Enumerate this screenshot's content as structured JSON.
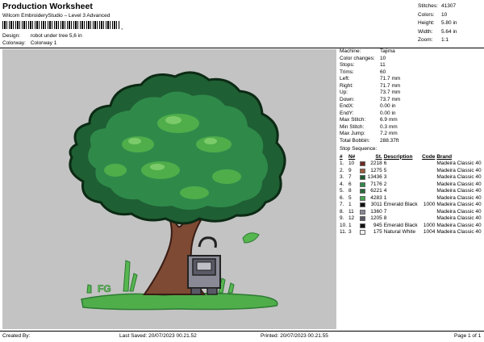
{
  "header": {
    "title": "Production Worksheet",
    "subtitle": "Wilcom EmbroideryStudio – Level 3 Advanced",
    "barcode_tick": ","
  },
  "meta": {
    "design_label": "Design:",
    "design_value": "robot under  tree 5,6 in",
    "colorway_label": "Colorway:",
    "colorway_value": "Colorway 1"
  },
  "stats": [
    {
      "k": "Stitches:",
      "v": "41307"
    },
    {
      "k": "Colors:",
      "v": "10"
    },
    {
      "k": "Height:",
      "v": "5.80 in"
    },
    {
      "k": "Width:",
      "v": "5.64 in"
    },
    {
      "k": "Zoom:",
      "v": "1:1"
    }
  ],
  "machine_info": [
    {
      "k": "Machine:",
      "v": "Tajima"
    },
    {
      "k": "Color changes:",
      "v": "10"
    },
    {
      "k": "Stops:",
      "v": "11"
    },
    {
      "k": "Trims:",
      "v": "60"
    },
    {
      "k": "Left:",
      "v": "71.7 mm"
    },
    {
      "k": "Right:",
      "v": "71.7 mm"
    },
    {
      "k": "Up:",
      "v": "73.7 mm"
    },
    {
      "k": "Down:",
      "v": "73.7 mm"
    },
    {
      "k": "EndX:",
      "v": "0.00 in"
    },
    {
      "k": "EndY:",
      "v": "0.00 in"
    },
    {
      "k": "Max Stitch:",
      "v": "6.9 mm"
    },
    {
      "k": "Min Stitch:",
      "v": "0.3 mm"
    },
    {
      "k": "Max Jump:",
      "v": "7.2 mm"
    },
    {
      "k": "Total Bobbin:",
      "v": "288.37ft"
    }
  ],
  "stop_sequence": {
    "label": "Stop Sequence:",
    "headers": {
      "stop": "#",
      "n": "N#",
      "st": "St.",
      "desc": "Description",
      "code": "Code",
      "brand": "Brand"
    },
    "rows": [
      {
        "stop": "1.",
        "n": "10",
        "color": "#6e2a24",
        "st": "2218",
        "desc": "6",
        "code": "",
        "brand": "Madeira Classic 40"
      },
      {
        "stop": "2.",
        "n": "9",
        "color": "#9c5a3c",
        "st": "1275",
        "desc": "5",
        "code": "",
        "brand": "Madeira Classic 40"
      },
      {
        "stop": "3.",
        "n": "7",
        "color": "#1d5a30",
        "st": "13436",
        "desc": "3",
        "code": "",
        "brand": "Madeira Classic 40"
      },
      {
        "stop": "4.",
        "n": "6",
        "color": "#2f8a4a",
        "st": "7176",
        "desc": "2",
        "code": "",
        "brand": "Madeira Classic 40"
      },
      {
        "stop": "5.",
        "n": "8",
        "color": "#2a6a3c",
        "st": "6221",
        "desc": "4",
        "code": "",
        "brand": "Madeira Classic 40"
      },
      {
        "stop": "6.",
        "n": "5",
        "color": "#45a550",
        "st": "4283",
        "desc": "1",
        "code": "",
        "brand": "Madeira Classic 40"
      },
      {
        "stop": "7.",
        "n": "1",
        "color": "#111111",
        "st": "3011",
        "desc": "Emerald Black",
        "code": "1000",
        "brand": "Madeira Classic 40"
      },
      {
        "stop": "8.",
        "n": "11",
        "color": "#8a8a96",
        "st": "1360",
        "desc": "7",
        "code": "",
        "brand": "Madeira Classic 40"
      },
      {
        "stop": "9.",
        "n": "12",
        "color": "#5a5a66",
        "st": "1205",
        "desc": "8",
        "code": "",
        "brand": "Madeira Classic 40"
      },
      {
        "stop": "10.",
        "n": "1",
        "color": "#111111",
        "st": "945",
        "desc": "Emerald Black",
        "code": "1000",
        "brand": "Madeira Classic 40"
      },
      {
        "stop": "11.",
        "n": "3",
        "color": "#f2f2f2",
        "st": "175",
        "desc": "Natural White",
        "code": "1004",
        "brand": "Madeira Classic 40"
      }
    ]
  },
  "preview": {
    "bg": "#c3c3c3",
    "ground_text": "FG"
  },
  "footer": {
    "created_by": "Created By:",
    "last_saved": "Last Saved: 20/07/2023 00.21.52",
    "printed": "Printed: 20/07/2023 00.21.55",
    "page": "Page 1 of 1"
  }
}
